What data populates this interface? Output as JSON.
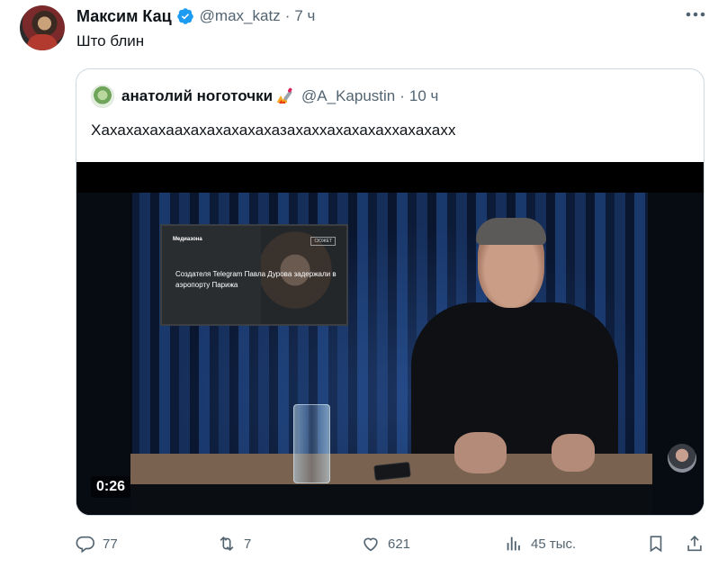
{
  "tweet": {
    "author_name": "Максим Кац",
    "handle": "@max_katz",
    "separator": "·",
    "time": "7 ч",
    "text": "Што блин"
  },
  "quote": {
    "author_name": "анатолий ноготочки",
    "handle": "@A_Kapustin",
    "separator": "·",
    "time": "10 ч",
    "text": "Хахахахахаахахахахахахазахаххахахахаххахахахх"
  },
  "video": {
    "screen_brand": "Медиазона",
    "screen_tag": "СЮЖЕТ",
    "screen_headline": "Создателя Telegram Павла Дурова задержали в аэропорту Парижа",
    "duration": "0:26"
  },
  "actions": {
    "replies": "77",
    "reposts": "7",
    "likes": "621",
    "views": "45 тыс."
  },
  "colors": {
    "verified_blue": "#1d9bf0",
    "secondary_text": "#536471",
    "border": "#cfd9de"
  },
  "icons": [
    "verified-badge-icon",
    "more-icon",
    "fire-nail-emoji-icon",
    "reply-icon",
    "repost-icon",
    "like-icon",
    "views-icon",
    "bookmark-icon",
    "share-icon"
  ]
}
